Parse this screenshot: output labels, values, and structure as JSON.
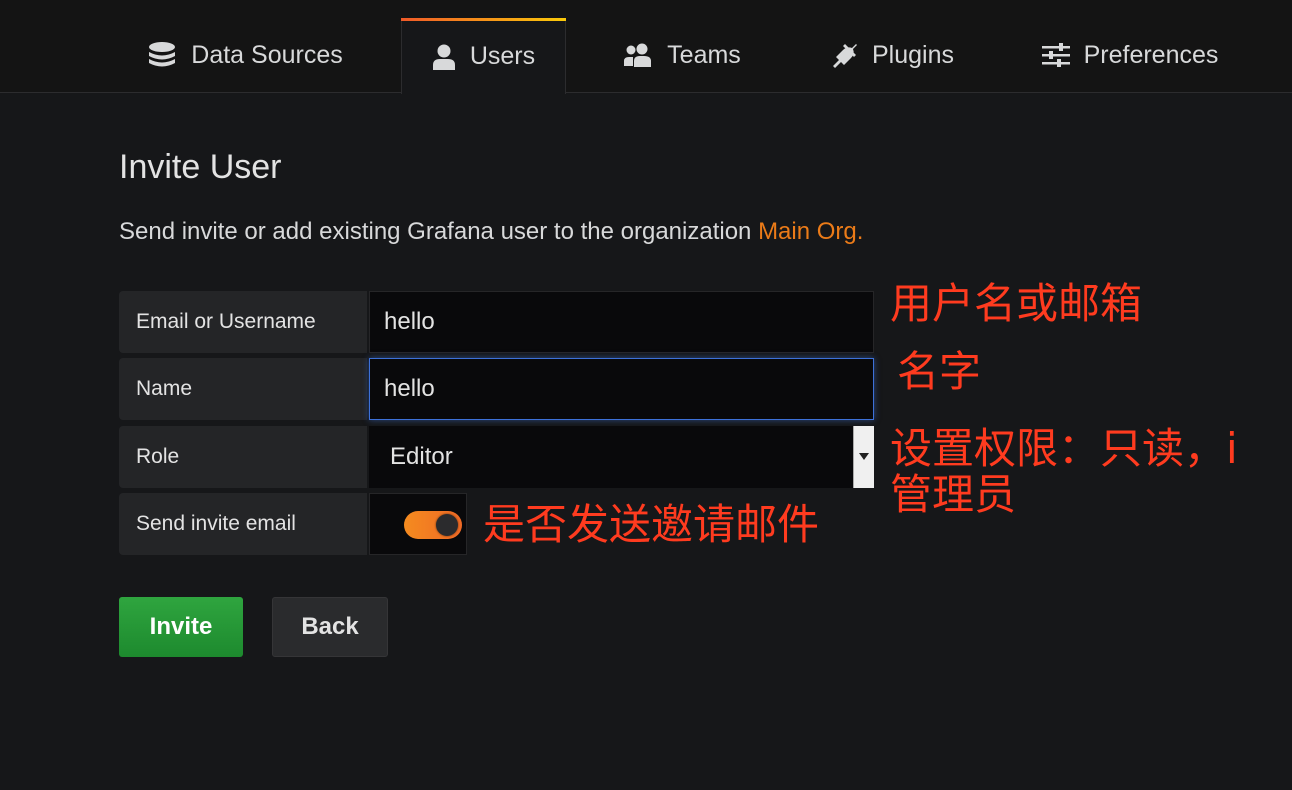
{
  "tabs": [
    {
      "label": "Data Sources",
      "icon": "database-icon",
      "active": false
    },
    {
      "label": "Users",
      "icon": "user-icon",
      "active": true
    },
    {
      "label": "Teams",
      "icon": "users-icon",
      "active": false
    },
    {
      "label": "Plugins",
      "icon": "plug-icon",
      "active": false
    },
    {
      "label": "Preferences",
      "icon": "sliders-icon",
      "active": false
    }
  ],
  "page": {
    "title": "Invite User",
    "subtitle_text": "Send invite or add existing Grafana user to the organization ",
    "org_name": "Main Org."
  },
  "form": {
    "email": {
      "label": "Email or Username",
      "value": "hello"
    },
    "name": {
      "label": "Name",
      "value": "hello"
    },
    "role": {
      "label": "Role",
      "value": "Editor"
    },
    "send_email": {
      "label": "Send invite email",
      "checked": true
    }
  },
  "buttons": {
    "invite": "Invite",
    "back": "Back"
  },
  "annotations": {
    "email": "用户名或邮箱",
    "name": "名字",
    "role_line1": "设置权限：只读，i",
    "role_line2": "管理员",
    "send_email": "是否发送邀请邮件"
  },
  "colors": {
    "accent_orange": "#eb7b18",
    "annotation_red": "#ff3b1f",
    "invite_green": "#2fa53f",
    "focus_blue": "#3d71d9"
  }
}
